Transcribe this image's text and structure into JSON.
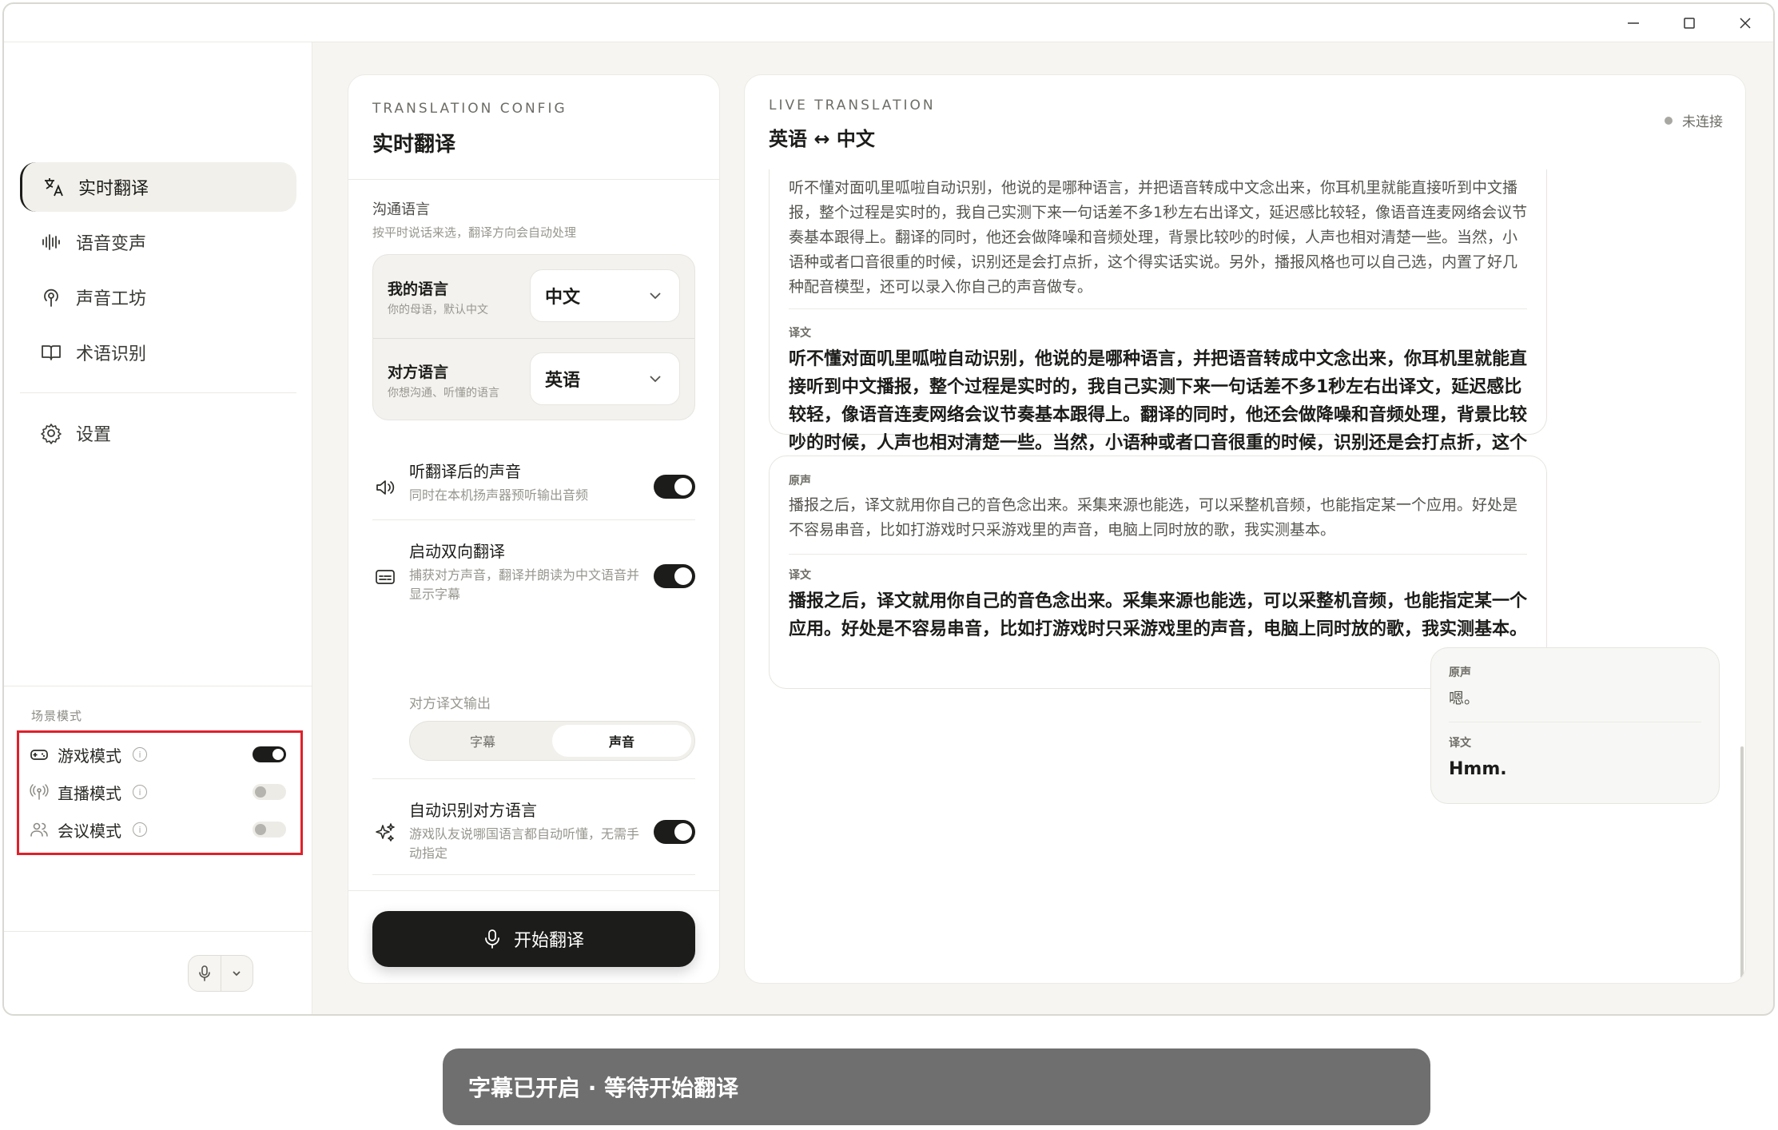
{
  "window": {
    "minimize_icon": "minimize-icon",
    "maximize_icon": "maximize-icon",
    "close_icon": "close-icon"
  },
  "sidebar": {
    "items": [
      {
        "label": "实时翻译",
        "icon": "translate-icon",
        "active": true
      },
      {
        "label": "语音变声",
        "icon": "waveform-icon"
      },
      {
        "label": "声音工坊",
        "icon": "broadcast-icon"
      },
      {
        "label": "术语识别",
        "icon": "book-icon"
      },
      {
        "label": "设置",
        "icon": "gear-icon"
      }
    ],
    "scene_label": "场景模式",
    "scenes": [
      {
        "label": "游戏模式",
        "icon": "gamepad-icon",
        "on": true
      },
      {
        "label": "直播模式",
        "icon": "live-antenna-icon",
        "on": false
      },
      {
        "label": "会议模式",
        "icon": "people-icon",
        "on": false
      }
    ]
  },
  "config": {
    "eyebrow": "TRANSLATION CONFIG",
    "title": "实时翻译",
    "lang_section": {
      "title": "沟通语言",
      "subtitle": "按平时说话来选，翻译方向会自动处理"
    },
    "my_lang": {
      "label": "我的语言",
      "sub": "你的母语，默认中文",
      "value": "中文"
    },
    "peer_lang": {
      "label": "对方语言",
      "sub": "你想沟通、听懂的语言",
      "value": "英语"
    },
    "options": [
      {
        "title": "听翻译后的声音",
        "sub": "同时在本机扬声器预听输出音频",
        "icon": "speaker-icon",
        "on": true
      },
      {
        "title": "启动双向翻译",
        "sub": "捕获对方声音，翻译并朗读为中文语音并显示字幕",
        "icon": "subtitle-icon",
        "on": true
      },
      {
        "title": "自动识别对方语言",
        "sub": "游戏队友说哪国语言都自动听懂，无需手动指定",
        "icon": "sparkle-icon",
        "on": true
      }
    ],
    "output_label": "对方译文输出",
    "output_options": [
      "字幕",
      "声音"
    ],
    "output_selected": "声音",
    "start_button": "开始翻译"
  },
  "live": {
    "eyebrow": "LIVE TRANSLATION",
    "title": "英语 ↔ 中文",
    "status": "未连接",
    "messages": [
      {
        "source": "听不懂对面叽里呱啦自动识别，他说的是哪种语言，并把语音转成中文念出来，你耳机里就能直接听到中文播报，整个过程是实时的，我自己实测下来一句话差不多1秒左右出译文，延迟感比较轻，像语音连麦网络会议节奏基本跟得上。翻译的同时，他还会做降噪和音频处理，背景比较吵的时候，人声也相对清楚一些。当然，小语种或者口音很重的时候，识别还是会打点折，这个得实话实说。另外，播报风格也可以自己选，内置了好几种配音模型，还可以录入你自己的声音做专。",
        "target_label": "译文",
        "target": "听不懂对面叽里呱啦自动识别，他说的是哪种语言，并把语音转成中文念出来，你耳机里就能直接听到中文播报，整个过程是实时的，我自己实测下来一句话差不多1秒左右出译文，延迟感比较轻，像语音连麦网络会议节奏基本跟得上。翻译的同时，他还会做降噪和音频处理，背景比较吵的时候，人声也相对清楚一些。当然，小语种或者口音很重的时候，识别还是会打点折，这个得实话实说。另外，播报风格也可以自己选，内置了好几种配音模型，还可以录入你自己的声音做专。"
      },
      {
        "source_label": "原声",
        "source": "播报之后，译文就用你自己的音色念出来。采集来源也能选，可以采整机音频，也能指定某一个应用。好处是不容易串音，比如打游戏时只采游戏里的声音，电脑上同时放的歌，我实测基本。",
        "target_label": "译文",
        "target": "播报之后，译文就用你自己的音色念出来。采集来源也能选，可以采整机音频，也能指定某一个应用。好处是不容易串音，比如打游戏时只采游戏里的声音，电脑上同时放的歌，我实测基本。"
      },
      {
        "source_label": "原声",
        "source": "嗯。",
        "target_label": "译文",
        "target": "Hmm."
      }
    ]
  },
  "toast": "字幕已开启 · 等待开始翻译"
}
